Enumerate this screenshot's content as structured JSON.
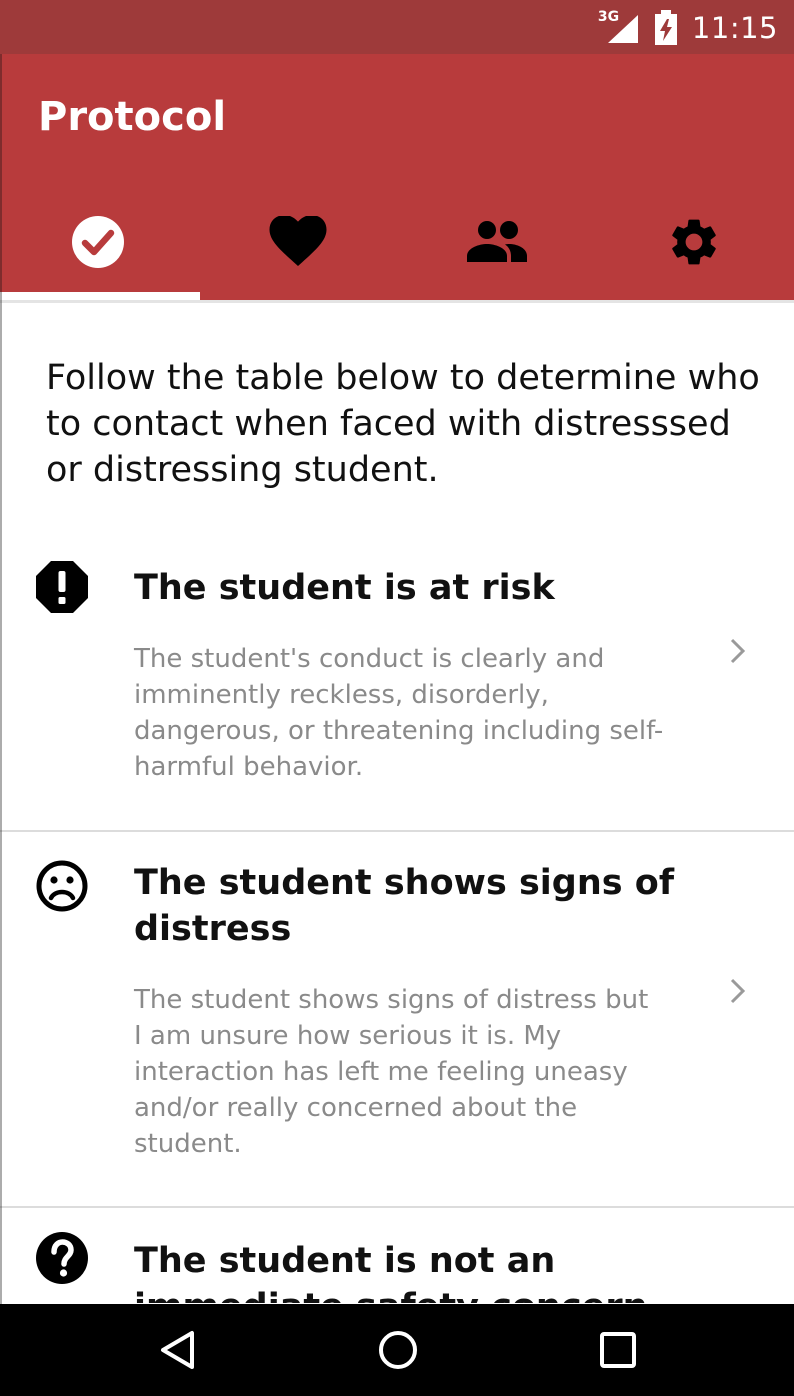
{
  "status_bar": {
    "network": "3G",
    "time": "11:15"
  },
  "app_bar": {
    "title": "Protocol",
    "tabs": [
      {
        "icon": "check-circle-icon",
        "selected": true
      },
      {
        "icon": "heart-icon",
        "selected": false
      },
      {
        "icon": "people-icon",
        "selected": false
      },
      {
        "icon": "gear-icon",
        "selected": false
      }
    ]
  },
  "content": {
    "intro": "Follow the table below to determine who to contact when faced with distresssed or distressing student.",
    "items": [
      {
        "icon": "alert-octagon-icon",
        "title": "The student is at risk",
        "description": "The student's conduct is clearly and imminently reckless, disorderly, dangerous, or threatening including self-harmful behavior."
      },
      {
        "icon": "sad-face-icon",
        "title": "The student shows signs of distress",
        "description": "The student shows signs of distress but I am unsure how serious it is. My interaction has left me feeling uneasy and/or really concerned about the student."
      },
      {
        "icon": "help-circle-icon",
        "title": "The student is not an immediate safety concern",
        "description": ""
      }
    ]
  },
  "colors": {
    "status_bar": "#9e3a3a",
    "app_bar": "#b83b3c",
    "description_text": "#8a8a8a",
    "nav_bar": "#000000"
  },
  "nav_bar": {
    "buttons": [
      "back-icon",
      "home-icon",
      "recents-icon"
    ]
  }
}
